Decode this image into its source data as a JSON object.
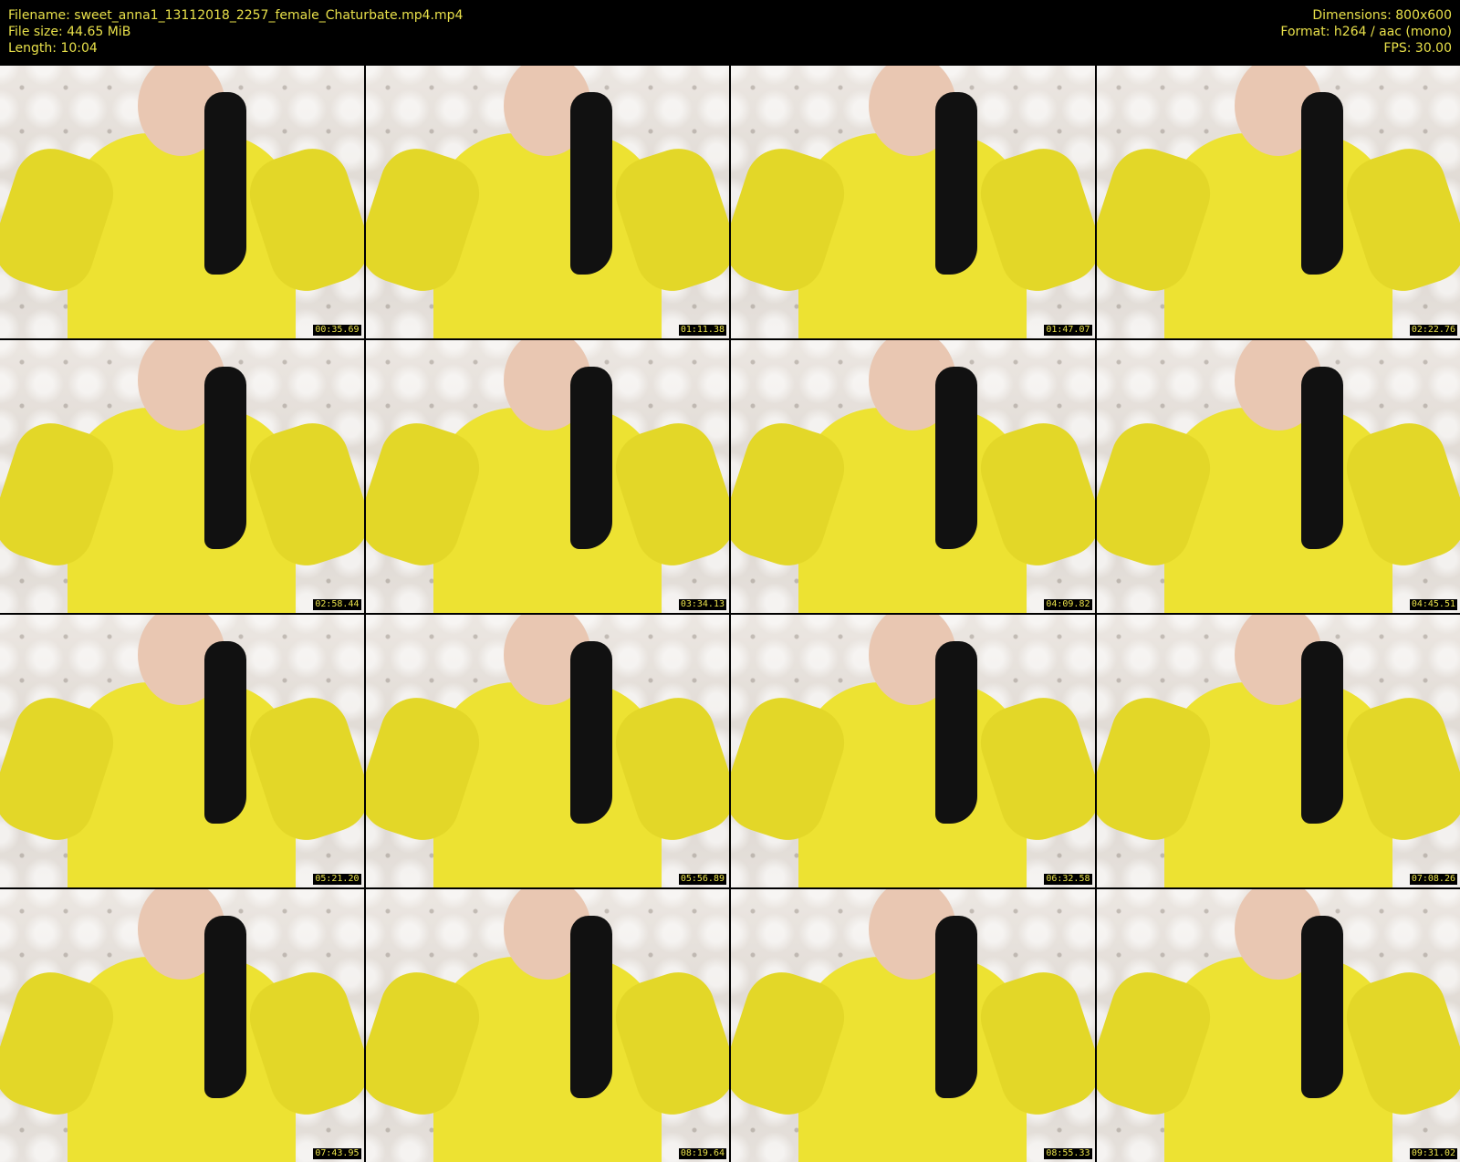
{
  "header": {
    "filename": "Filename: sweet_anna1_13112018_2257_female_Chaturbate.mp4.mp4",
    "file_size": "File size: 44.65 MiB",
    "length": "Length: 10:04",
    "dimensions": "Dimensions: 800x600",
    "format": "Format: h264 / aac (mono)",
    "fps": "FPS: 30.00"
  },
  "colors": {
    "background": "#000000",
    "text": "#e8e04a"
  },
  "thumbnails": [
    {
      "timestamp": "00:35.69"
    },
    {
      "timestamp": "01:11.38"
    },
    {
      "timestamp": "01:47.07"
    },
    {
      "timestamp": "02:22.76"
    },
    {
      "timestamp": "02:58.44"
    },
    {
      "timestamp": "03:34.13"
    },
    {
      "timestamp": "04:09.82"
    },
    {
      "timestamp": "04:45.51"
    },
    {
      "timestamp": "05:21.20"
    },
    {
      "timestamp": "05:56.89"
    },
    {
      "timestamp": "06:32.58"
    },
    {
      "timestamp": "07:08.26"
    },
    {
      "timestamp": "07:43.95"
    },
    {
      "timestamp": "08:19.64"
    },
    {
      "timestamp": "08:55.33"
    },
    {
      "timestamp": "09:31.02"
    }
  ]
}
